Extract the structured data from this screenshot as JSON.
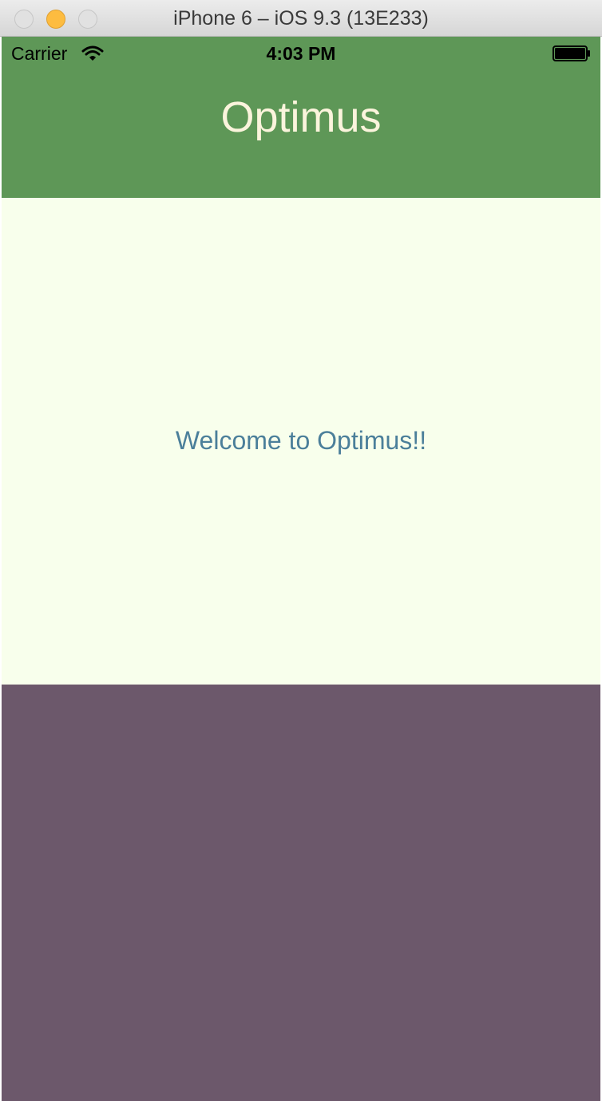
{
  "window": {
    "title": "iPhone 6 – iOS 9.3 (13E233)"
  },
  "status_bar": {
    "carrier": "Carrier",
    "time": "4:03 PM",
    "icons": [
      "wifi-icon",
      "battery-icon"
    ]
  },
  "header": {
    "title": "Optimus",
    "background_color": "#5e9757",
    "title_color": "#fbf4dc"
  },
  "content": {
    "welcome_text": "Welcome to Optimus!!",
    "background_color": "#f8ffec",
    "text_color": "#4b7f9a"
  },
  "footer": {
    "background_color": "#6c586b"
  }
}
